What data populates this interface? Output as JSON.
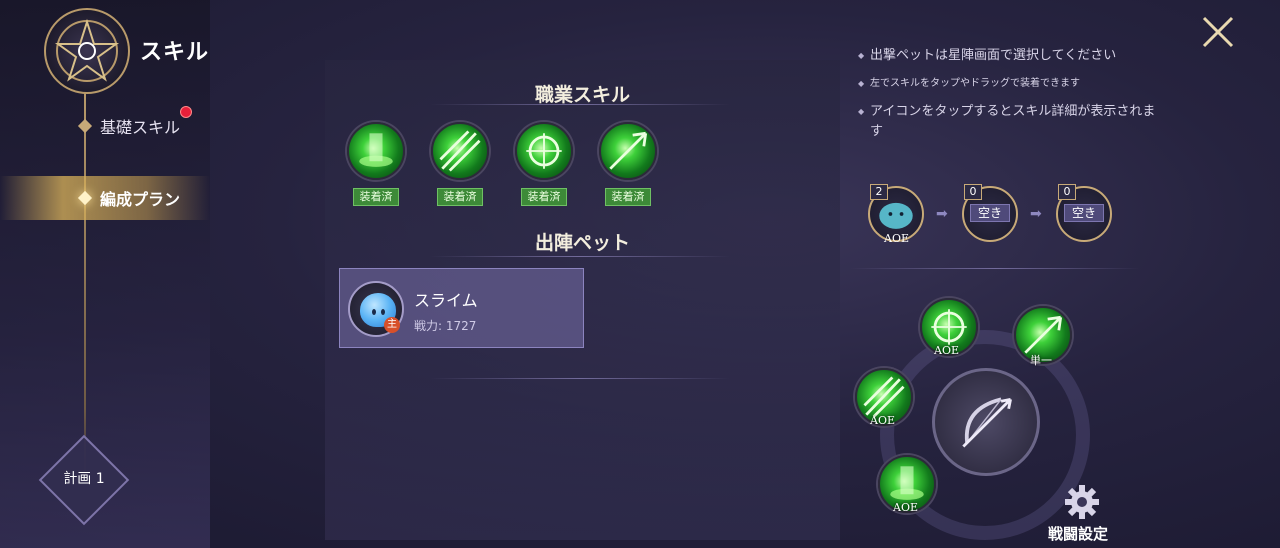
{
  "header": {
    "title": "スキル"
  },
  "sidebar": {
    "items": [
      {
        "label": "基礎スキル",
        "has_notification": true
      },
      {
        "label": "編成プラン",
        "selected": true
      }
    ],
    "plan_badge": "計画 1"
  },
  "job_skills": {
    "title": "職業スキル",
    "skills": [
      {
        "icon": "green-pillar-skill-icon",
        "tag": "装着済"
      },
      {
        "icon": "green-slash-skill-icon",
        "tag": "装着済"
      },
      {
        "icon": "green-target-skill-icon",
        "tag": "装着済"
      },
      {
        "icon": "green-arrow-skill-icon",
        "tag": "装着済"
      }
    ]
  },
  "pet_section": {
    "title": "出陣ペット",
    "pet": {
      "name": "スライム",
      "power": "戦力: 1727",
      "badge": "主"
    }
  },
  "tips": [
    "出撃ペットは星陣画面で選択してください",
    "左でスキルをタップやドラッグで装着できます",
    "アイコンをタップするとスキル詳細が表示されます"
  ],
  "chain": [
    {
      "num": "2",
      "label": "AOE",
      "filled": true
    },
    {
      "num": "0",
      "label": "空き",
      "filled": false
    },
    {
      "num": "0",
      "label": "空き",
      "filled": false
    }
  ],
  "wheel": [
    {
      "label": "AOE",
      "icon": "green-target-skill-icon"
    },
    {
      "label": "単一",
      "icon": "green-arrow-skill-icon"
    },
    {
      "label": "AOE",
      "icon": "green-slash-skill-icon"
    },
    {
      "label": "AOE",
      "icon": "green-pillar-skill-icon"
    }
  ],
  "battle_settings": {
    "label": "戦闘設定"
  },
  "colors": {
    "accent_gold": "#c8aa78",
    "skill_green": "#3ed13a",
    "notify_red": "#e8203a"
  }
}
